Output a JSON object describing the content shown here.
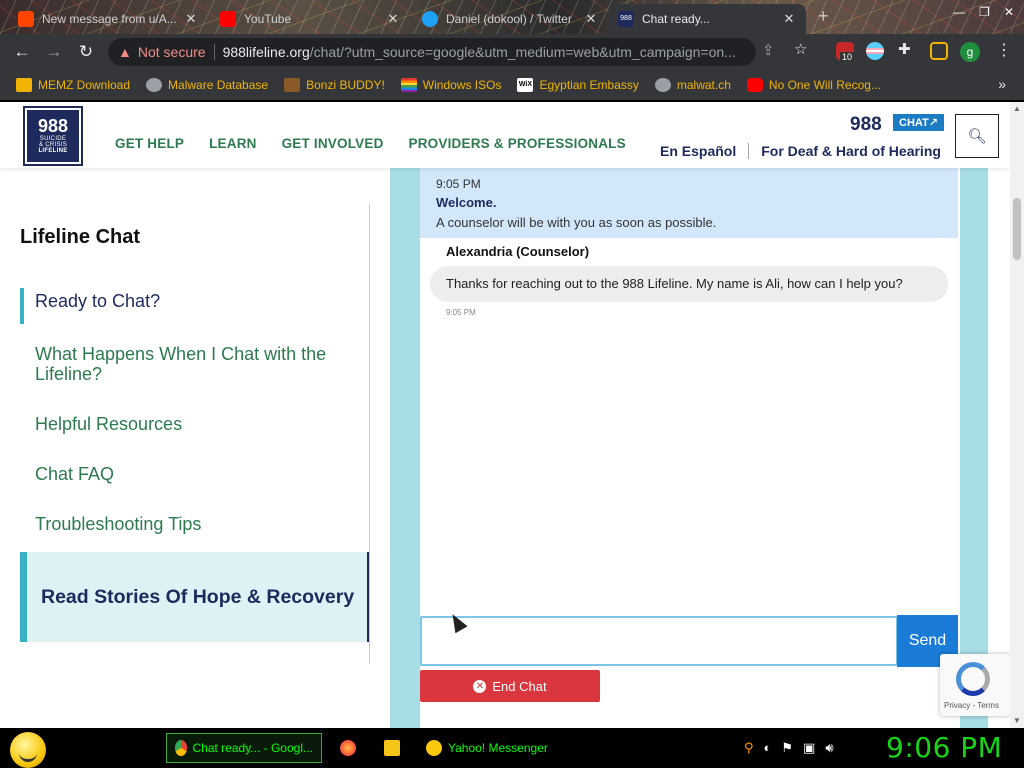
{
  "browser": {
    "tabs": [
      {
        "title": "New message from u/A...",
        "favicon_color": "#ff4500",
        "active": false
      },
      {
        "title": "YouTube",
        "favicon_color": "#ff0000",
        "active": false
      },
      {
        "title": "Daniel (dokool) / Twitter",
        "favicon_color": "#1da1f2",
        "active": false
      },
      {
        "title": "Chat ready...",
        "favicon_color": "#1d2a5b",
        "active": true
      }
    ],
    "new_tab_glyph": "+",
    "not_secure_label": "Not secure",
    "url_host": "988lifeline.org",
    "url_rest": "/chat/?utm_source=google&utm_medium=web&utm_campaign=on...",
    "extension_badge": "10",
    "profile_initial": "g",
    "bookmarks": [
      {
        "label": "MEMZ Download",
        "icon": "folder-icon",
        "color": "#f0b400"
      },
      {
        "label": "Malware Database",
        "icon": "globe-icon",
        "color": "#9aa0a6"
      },
      {
        "label": "Bonzi BUDDY!",
        "icon": "gorilla-icon",
        "color": "#8a5a2b"
      },
      {
        "label": "Windows ISOs",
        "icon": "rainbow-flag-icon",
        "color": "#e53935"
      },
      {
        "label": "Egyptian Embassy",
        "icon": "wix-icon",
        "color": "#ffffff"
      },
      {
        "label": "malwat.ch",
        "icon": "globe-icon",
        "color": "#9aa0a6"
      },
      {
        "label": "No One Will Recog...",
        "icon": "youtube-icon",
        "color": "#ff0000"
      }
    ],
    "bookmarks_more": "»"
  },
  "site": {
    "logo": {
      "big": "988",
      "line1": "SUICIDE",
      "line2": "& CRISIS",
      "line3": "LIFELINE"
    },
    "nav": [
      "GET HELP",
      "LEARN",
      "GET INVOLVED",
      "PROVIDERS & PROFESSIONALS"
    ],
    "hotline": "988",
    "chat_badge": "CHAT↗",
    "lang_links": [
      "En Español",
      "For Deaf & Hard of Hearing"
    ],
    "search_icon": "search-icon"
  },
  "sidebar": {
    "title": "Lifeline Chat",
    "items": [
      {
        "label": "Ready to Chat?",
        "active": true
      },
      {
        "label": "What Happens When I Chat with the Lifeline?",
        "active": false
      },
      {
        "label": "Helpful Resources",
        "active": false
      },
      {
        "label": "Chat FAQ",
        "active": false
      },
      {
        "label": "Troubleshooting Tips",
        "active": false
      }
    ],
    "stories_label": "Read Stories Of Hope & Recovery"
  },
  "chat": {
    "welcome_time": "9:05 PM",
    "welcome_title": "Welcome.",
    "welcome_text": "A counselor will be with you as soon as possible.",
    "sender": "Alexandria (Counselor)",
    "message": "Thanks for reaching out to the 988 Lifeline. My name is Ali, how can I help you?",
    "message_time": "9:05 PM",
    "input_value": "",
    "send_label": "Send",
    "end_label": "End Chat",
    "recaptcha_links": "Privacy - Terms"
  },
  "taskbar": {
    "items": [
      {
        "label": "Chat ready... - Googl...",
        "icon": "chrome-icon",
        "active": true
      },
      {
        "label": "",
        "icon": "firefox-icon",
        "active": false
      },
      {
        "label": "",
        "icon": "folder-icon",
        "active": false
      },
      {
        "label": "Yahoo! Messenger",
        "icon": "yahoo-messenger-icon",
        "active": false
      }
    ],
    "clock": "9:06 PM"
  }
}
